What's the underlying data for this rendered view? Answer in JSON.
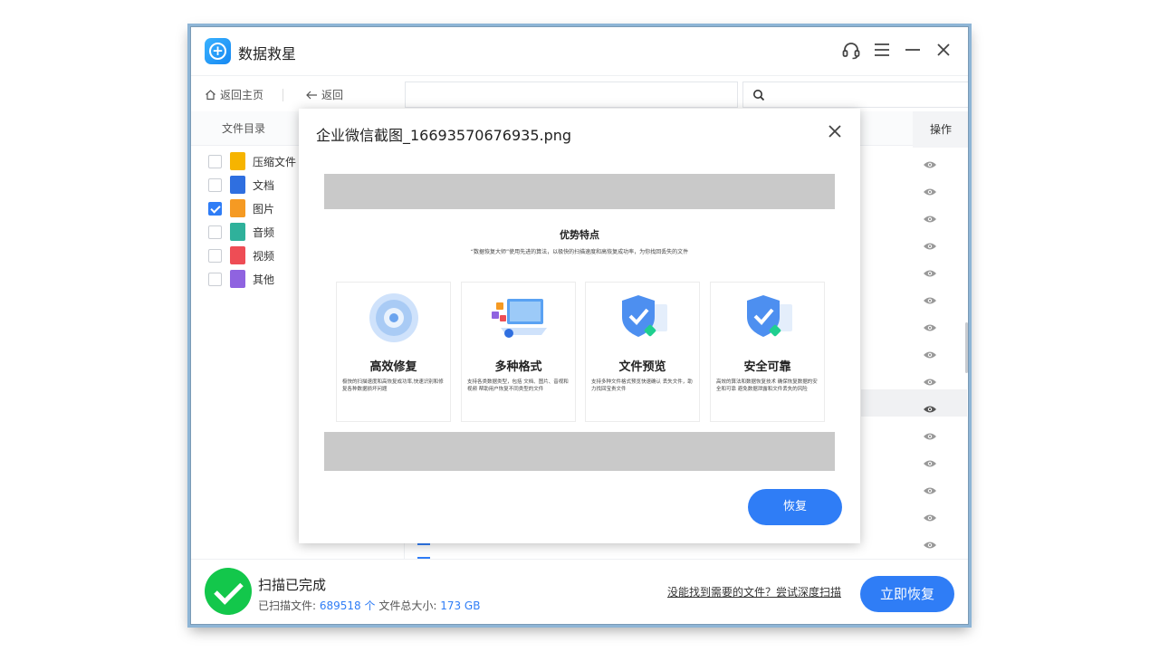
{
  "app": {
    "title": "数据救星"
  },
  "toolbar": {
    "back_home": "返回主页",
    "back": "返回",
    "path": "",
    "search_placeholder": ""
  },
  "sidebar": {
    "header": "文件目录",
    "items": [
      {
        "label": "压缩文件",
        "checked": false,
        "color": "#f6b400"
      },
      {
        "label": "文档",
        "checked": false,
        "color": "#2f6fe0"
      },
      {
        "label": "图片",
        "checked": true,
        "color": "#f59a23"
      },
      {
        "label": "音频",
        "checked": false,
        "color": "#2fb19b"
      },
      {
        "label": "视频",
        "checked": false,
        "color": "#ee4d55"
      },
      {
        "label": "其他",
        "checked": false,
        "color": "#8f63e0"
      }
    ]
  },
  "list": {
    "op_header": "操作",
    "eye_count": 15
  },
  "status": {
    "title": "扫描已完成",
    "scanned_label": "已扫描文件:",
    "scanned_count": "689518 个",
    "size_label": "文件总大小:",
    "size_value": "173 GB",
    "deep_scan_link": "没能找到需要的文件？尝试深度扫描",
    "recover_now": "立即恢复"
  },
  "modal": {
    "title": "企业微信截图_16693570676935.png",
    "recover_button": "恢复",
    "preview": {
      "heading": "优势特点",
      "subtitle": "“数据恢复大师”使用先进的算法，以极快的扫描速度和高恢复成功率，为你找回丢失的文件",
      "cards": [
        {
          "title": "高效修复",
          "desc": "极快的扫描速度和高恢复成功率,快速识别和修复各种数据损坏问题"
        },
        {
          "title": "多种格式",
          "desc": "支持各类数据类型，包括 文档、图片、音视和视频 帮助用户恢复不同类型的文件"
        },
        {
          "title": "文件预览",
          "desc": "支持多种文件格式预览快速确认 丢失文件，助力找回宝贵文件"
        },
        {
          "title": "安全可靠",
          "desc": "高效的算法和数据恢复技术 确保恢复数据的安全和可靠 避免数据泄露和文件丢失的风险"
        }
      ]
    }
  },
  "colors": {
    "accent": "#2f7df6",
    "success": "#13c74b"
  }
}
